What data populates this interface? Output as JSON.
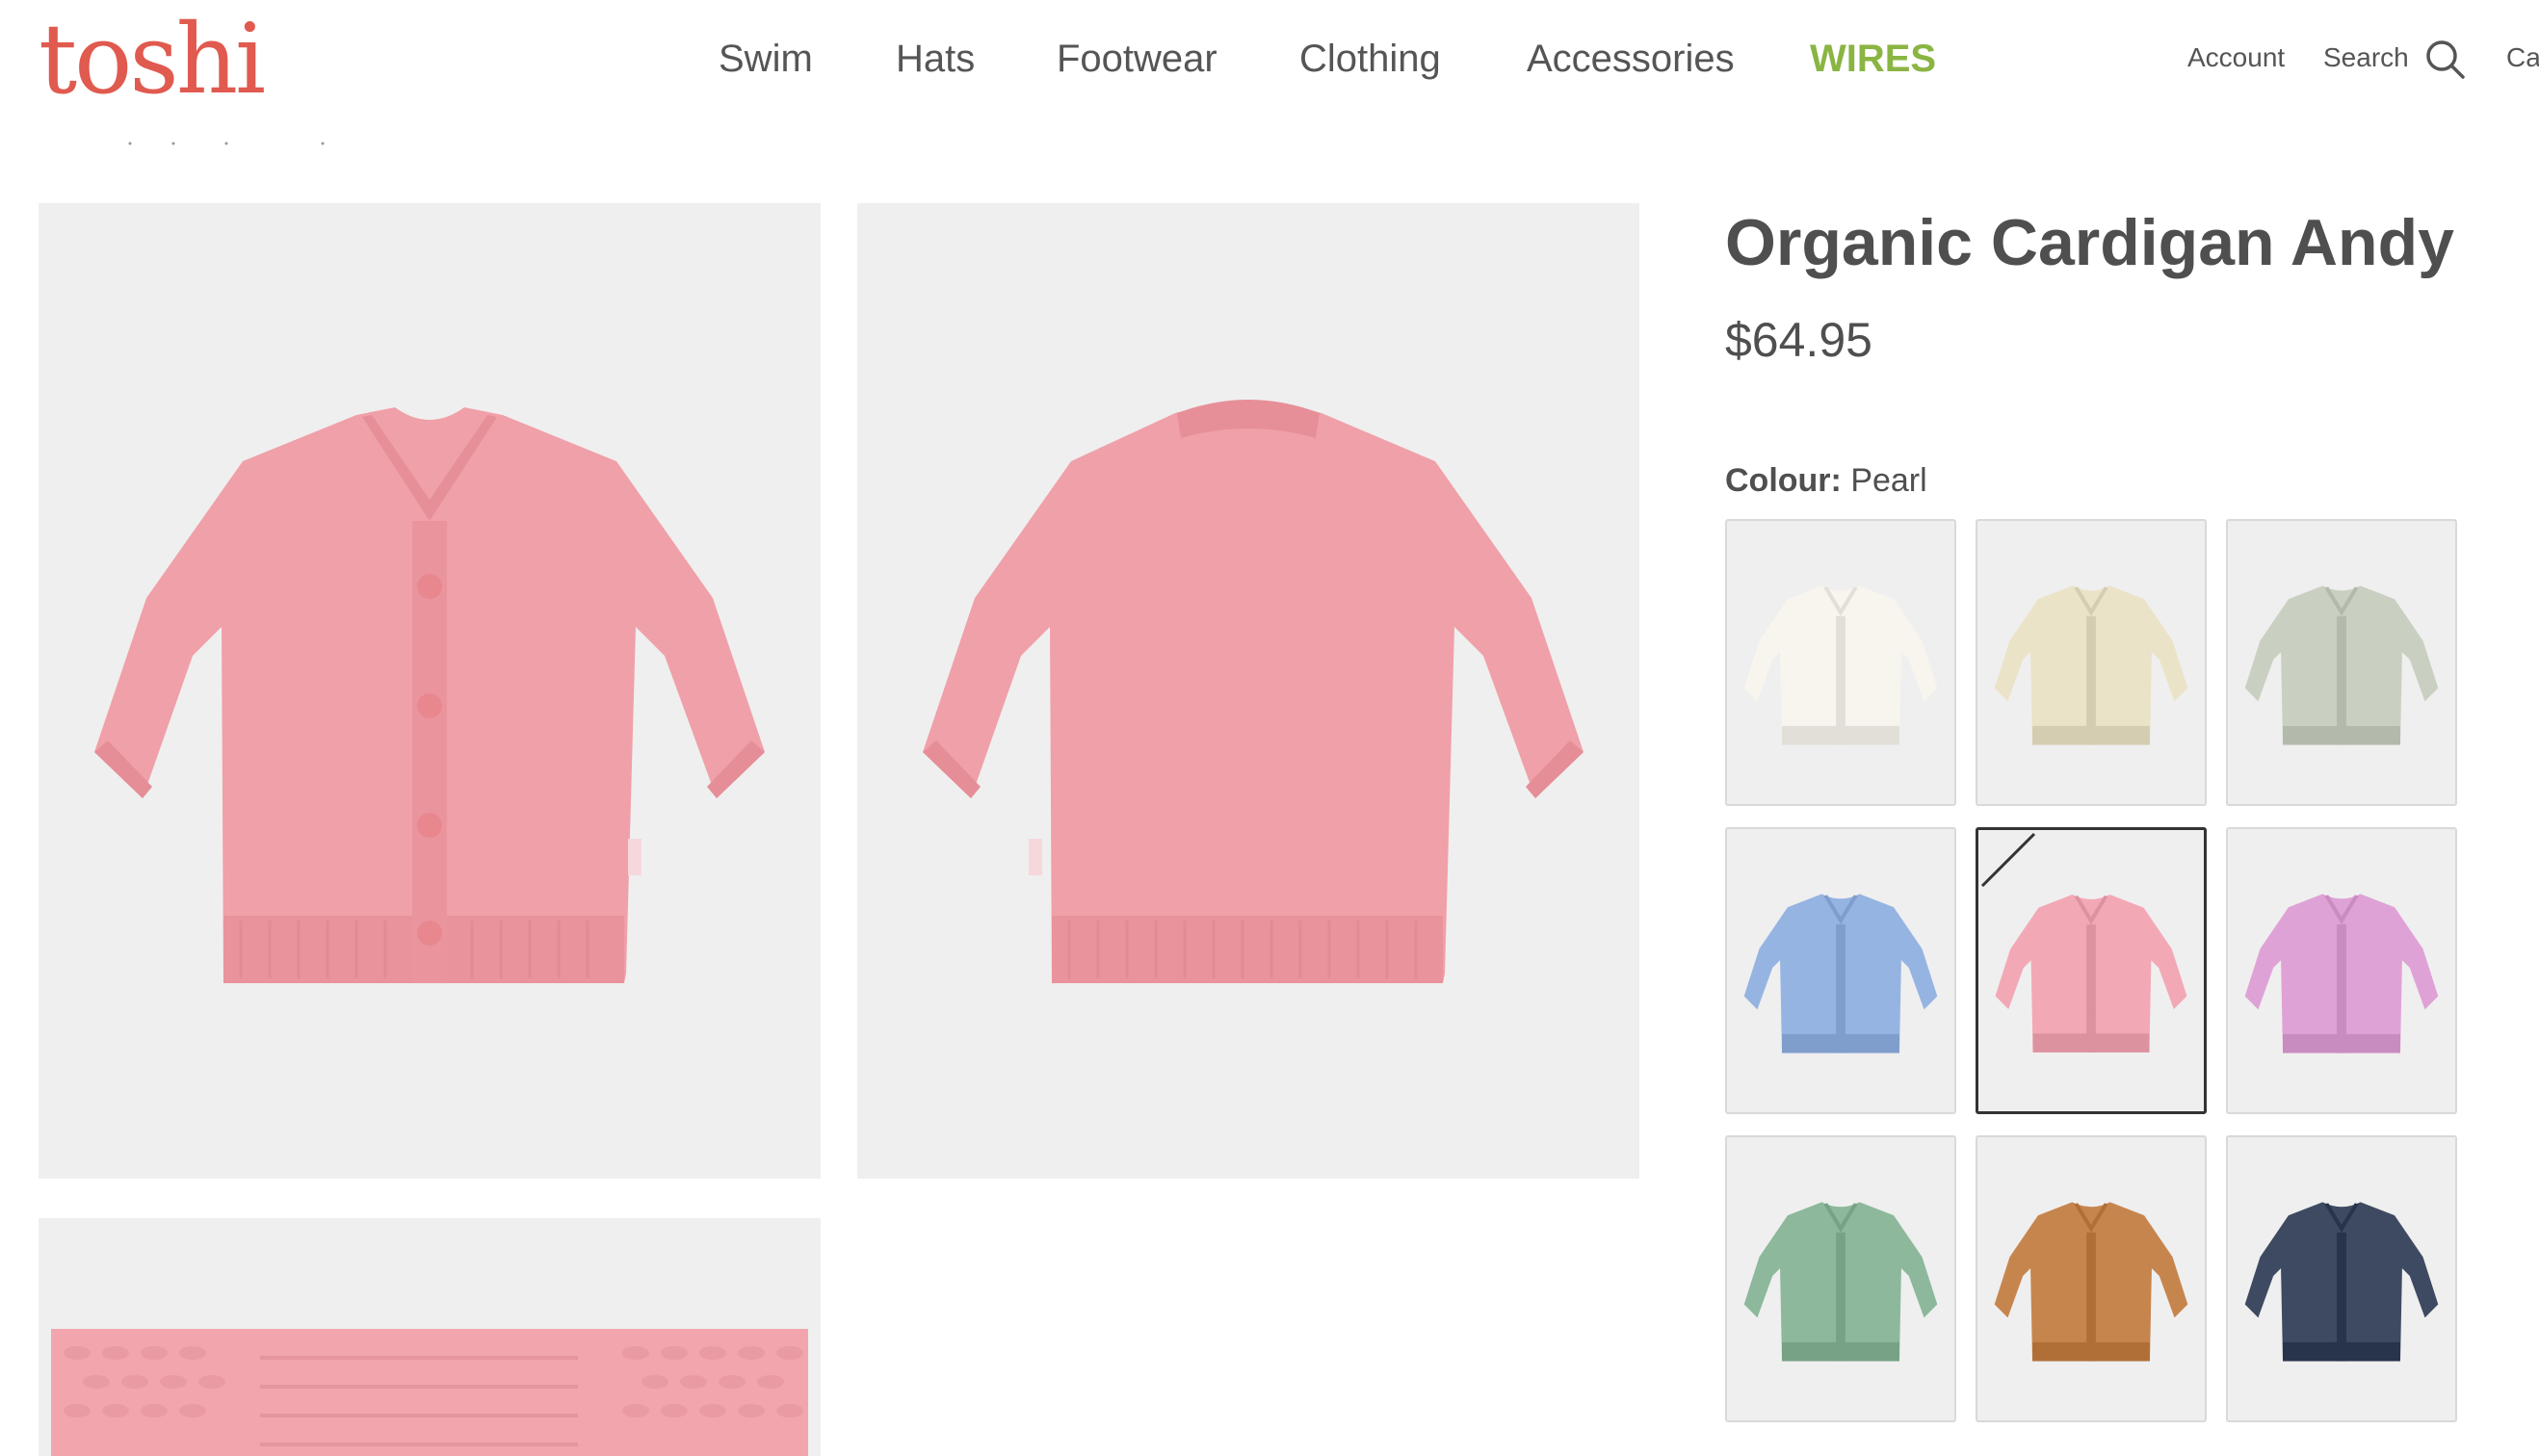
{
  "brand": {
    "logo_text": "toshi",
    "logo_color": "#e05a4f"
  },
  "nav": {
    "items": [
      {
        "label": "Swim"
      },
      {
        "label": "Hats"
      },
      {
        "label": "Footwear"
      },
      {
        "label": "Clothing"
      },
      {
        "label": "Accessories"
      },
      {
        "label": "WIRES",
        "highlight_color": "#8ab543"
      }
    ]
  },
  "utility": {
    "account_label": "Account",
    "search_label": "Search",
    "cart_label": "Ca",
    "search_icon": "search-icon"
  },
  "product": {
    "title": "Organic Cardigan Andy",
    "price": "$64.95",
    "colour_label": "Colour:",
    "colour_value": "Pearl"
  },
  "gallery": [
    {
      "view": "front",
      "color": "#f0a0a8"
    },
    {
      "view": "back",
      "color": "#f0a0a8"
    },
    {
      "view": "knit-detail",
      "color": "#f2a5ad"
    }
  ],
  "swatches": [
    {
      "color": "#f7f5ee",
      "selected": false
    },
    {
      "color": "#ebe3c8",
      "selected": false
    },
    {
      "color": "#c9d0c2",
      "selected": false
    },
    {
      "color": "#96b4e2",
      "selected": false
    },
    {
      "color": "#f3a8b6",
      "selected": true
    },
    {
      "color": "#dfa2d6",
      "selected": false
    },
    {
      "color": "#8db89c",
      "selected": false
    },
    {
      "color": "#c7854e",
      "selected": false
    },
    {
      "color": "#3e4a61",
      "selected": false
    }
  ]
}
